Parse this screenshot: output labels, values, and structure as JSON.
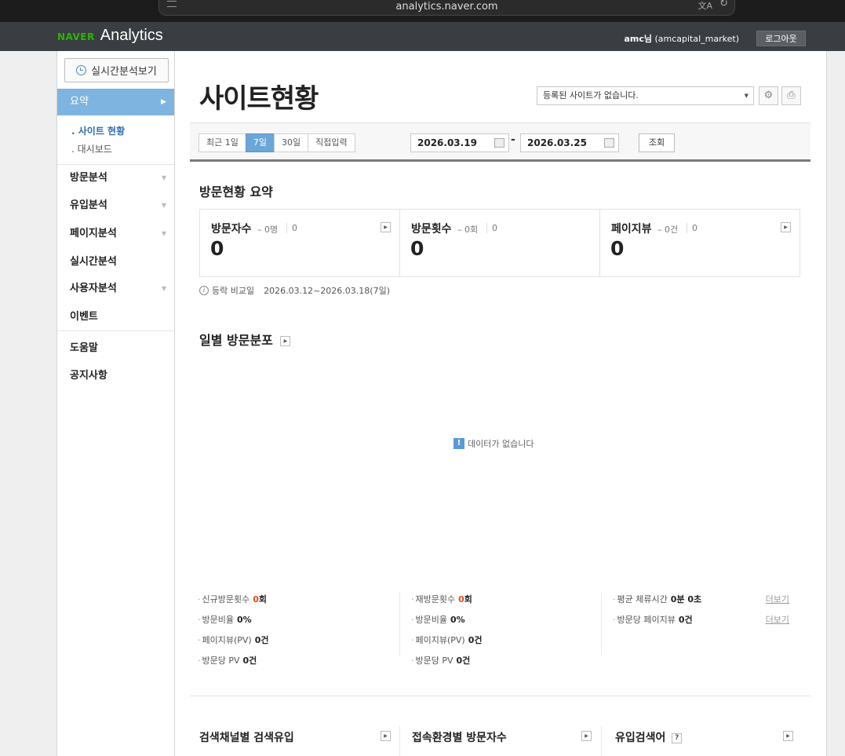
{
  "browser": {
    "url": "analytics.naver.com"
  },
  "header": {
    "brand_naver": "NAVER",
    "brand_product": "Analytics",
    "user_name": "amc님",
    "user_id": "(amcapital_market)",
    "logout_label": "로그아웃"
  },
  "sidebar": {
    "realtime_button": "실시간분석보기",
    "active_item": "요약",
    "sub_items": [
      ". 사이트 현황",
      ". 대시보드"
    ],
    "items": [
      "방문분석",
      "유입분석",
      "페이지분석",
      "실시간분석",
      "사용자분석",
      "이벤트",
      "도움말",
      "공지사항"
    ]
  },
  "main": {
    "title": "사이트현황",
    "site_select_value": "등록된 사이트가 없습니다.",
    "range_tabs": [
      "최근 1일",
      "7일",
      "30일",
      "직접입력"
    ],
    "active_range": "7일",
    "date_from": "2026.03.19",
    "date_to": "2026.03.25",
    "search_label": "조회",
    "summary_title": "방문현황 요약",
    "summary": [
      {
        "label": "방문자수",
        "delta": "– 0명",
        "prev": "0",
        "value": "0"
      },
      {
        "label": "방문횟수",
        "delta": "– 0회",
        "prev": "0",
        "value": "0"
      },
      {
        "label": "페이지뷰",
        "delta": "– 0건",
        "prev": "0",
        "value": "0"
      }
    ],
    "compare_label": "등락 비교일",
    "compare_range": "2026.03.12~2026.03.18(7일)",
    "daily_title": "일별 방문분포",
    "no_data": "데이터가 없습니다",
    "stats_col1": [
      {
        "label": "신규방문횟수",
        "value_hl": "0",
        "unit": "회"
      },
      {
        "label": "방문비율",
        "value_hl": "",
        "unit": "0%"
      },
      {
        "label": "페이지뷰(PV)",
        "value_hl": "",
        "unit": "0건"
      },
      {
        "label": "방문당 PV",
        "value_hl": "",
        "unit": "0건"
      }
    ],
    "stats_col2": [
      {
        "label": "재방문횟수",
        "value_hl": "0",
        "unit": "회"
      },
      {
        "label": "방문비율",
        "value_hl": "",
        "unit": "0%"
      },
      {
        "label": "페이지뷰(PV)",
        "value_hl": "",
        "unit": "0건"
      },
      {
        "label": "방문당 PV",
        "value_hl": "",
        "unit": "0건"
      }
    ],
    "stats_col3": [
      {
        "label": "평균 체류시간",
        "value_hl": "",
        "unit": "0분 0초"
      },
      {
        "label": "방문당 페이지뷰",
        "value_hl": "",
        "unit": "0건"
      }
    ],
    "more_label": "더보기",
    "bottom_sections": [
      "검색채널별 검색유입",
      "접속환경별 방문자수",
      "유입검색어"
    ],
    "help_icon": "?"
  }
}
